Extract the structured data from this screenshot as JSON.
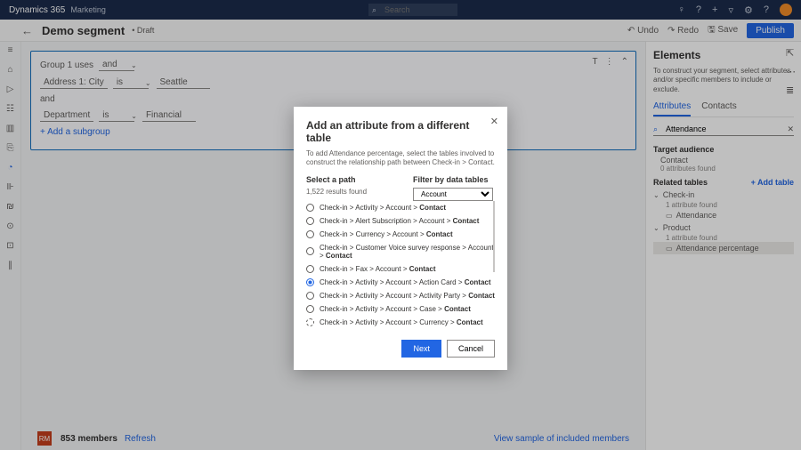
{
  "topbar": {
    "brand": "Dynamics 365",
    "module": "Marketing",
    "searchPlaceholder": "Search"
  },
  "cmd": {
    "title": "Demo segment",
    "status": "• Draft",
    "undo": "Undo",
    "redo": "Redo",
    "save": "Save",
    "publish": "Publish"
  },
  "seg": {
    "group": "Group 1 uses",
    "op": "and",
    "r1": {
      "attr": "Address 1: City",
      "cond": "is",
      "val": "Seattle"
    },
    "and": "and",
    "r2": {
      "attr": "Department",
      "cond": "is",
      "val": "Financial"
    },
    "add": "+  Add a subgroup"
  },
  "footer": {
    "badge": "RM",
    "members": "853 members",
    "refresh": "Refresh",
    "sample": "View sample of included members"
  },
  "rp": {
    "title": "Elements",
    "help": "To construct your segment, select attributes and/or specific members to include or exclude.",
    "tabs": [
      "Attributes",
      "Contacts"
    ],
    "searchVal": "Attendance",
    "ta": "Target audience",
    "contact": "Contact",
    "zero": "0 attributes found",
    "rt": "Related tables",
    "add": "+ Add table",
    "n1": "Check-in",
    "n1s": "1 attribute found",
    "n1a": "Attendance",
    "n2": "Product",
    "n2s": "1 attribute found",
    "n2a": "Attendance percentage"
  },
  "modal": {
    "title": "Add an attribute from a different table",
    "desc": "To add Attendance percentage, select the tables involved to construct the relationship path between Check-in > Contact.",
    "selPath": "Select a path",
    "found": "1,522 results found",
    "filter": "Filter by data tables",
    "filterVal": "Account",
    "paths": [
      {
        "t": "Check-in > Activity > Account > ",
        "b": "Contact",
        "sel": false
      },
      {
        "t": "Check-in > Alert Subscription > Account > ",
        "b": "Contact",
        "sel": false
      },
      {
        "t": "Check-in > Currency > Account > ",
        "b": "Contact",
        "sel": false
      },
      {
        "t": "Check-in > Customer Voice survey response > Account > ",
        "b": "Contact",
        "sel": false
      },
      {
        "t": "Check-in > Fax > Account > ",
        "b": "Contact",
        "sel": false
      },
      {
        "t": "Check-in > Activity > Account > Action Card > ",
        "b": "Contact",
        "sel": true
      },
      {
        "t": "Check-in > Activity > Account > Activity Party > ",
        "b": "Contact",
        "sel": false
      },
      {
        "t": "Check-in > Activity > Account > Case > ",
        "b": "Contact",
        "sel": false
      },
      {
        "t": "Check-in > Activity > Account > Currency > ",
        "b": "Contact",
        "sel": false,
        "sp": true
      }
    ],
    "next": "Next",
    "cancel": "Cancel"
  }
}
